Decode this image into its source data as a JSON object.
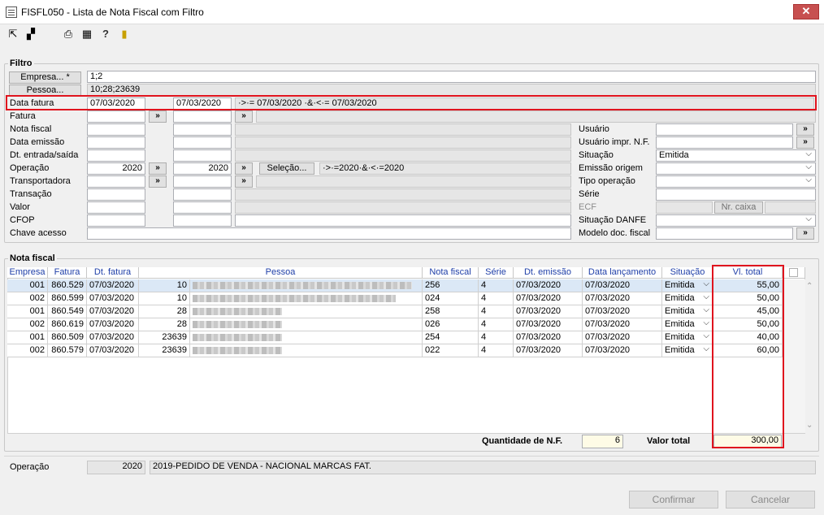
{
  "window": {
    "title": "FISFL050 - Lista de Nota Fiscal com Filtro",
    "close": "✕"
  },
  "filtro": {
    "title": "Filtro",
    "empresa": {
      "label": "Empresa... *",
      "value": "1;2"
    },
    "pessoa": {
      "label": "Pessoa...",
      "value": "10;28;23639"
    },
    "data_fatura": {
      "label": "Data fatura",
      "from": "07/03/2020",
      "to": "07/03/2020",
      "expr": "·>·= 07/03/2020 ·&·<·= 07/03/2020"
    },
    "fatura": {
      "label": "Fatura"
    },
    "nota_fiscal": {
      "label": "Nota fiscal"
    },
    "data_emissao": {
      "label": "Data emissão"
    },
    "dt_entrada_saida": {
      "label": "Dt. entrada/saída"
    },
    "operacao": {
      "label": "Operação",
      "from": "2020",
      "to": "2020",
      "selecao": "Seleção...",
      "expr": "·>·=2020·&·<·=2020"
    },
    "transportadora": {
      "label": "Transportadora"
    },
    "transacao": {
      "label": "Transação"
    },
    "valor": {
      "label": "Valor"
    },
    "cfop": {
      "label": "CFOP"
    },
    "chave_acesso": {
      "label": "Chave acesso"
    },
    "usuario": {
      "label": "Usuário"
    },
    "usuario_impr": {
      "label": "Usuário impr. N.F."
    },
    "situacao": {
      "label": "Situação",
      "value": "Emitida"
    },
    "emissao_origem": {
      "label": "Emissão origem"
    },
    "tipo_operacao": {
      "label": "Tipo operação"
    },
    "serie": {
      "label": "Série"
    },
    "ecf": {
      "label": "ECF",
      "nr_caixa": "Nr. caixa"
    },
    "situacao_danfe": {
      "label": "Situação DANFE"
    },
    "modelo_doc": {
      "label": "Modelo doc. fiscal"
    },
    "arrow": "»"
  },
  "nota_fiscal": {
    "title": "Nota fiscal",
    "columns": [
      "Empresa",
      "Fatura",
      "Dt. fatura",
      "Pessoa",
      "Nota fiscal",
      "Série",
      "Dt. emissão",
      "Data lançamento",
      "Situação",
      "Vl. total"
    ],
    "rows": [
      {
        "empresa": "001",
        "fatura": "860.529",
        "dt_fatura": "07/03/2020",
        "pessoa": "10",
        "nota": "256",
        "serie": "4",
        "dt_emissao": "07/03/2020",
        "data_lanc": "07/03/2020",
        "situacao": "Emitida",
        "vl_total": "55,00"
      },
      {
        "empresa": "002",
        "fatura": "860.599",
        "dt_fatura": "07/03/2020",
        "pessoa": "10",
        "nota": "024",
        "serie": "4",
        "dt_emissao": "07/03/2020",
        "data_lanc": "07/03/2020",
        "situacao": "Emitida",
        "vl_total": "50,00"
      },
      {
        "empresa": "001",
        "fatura": "860.549",
        "dt_fatura": "07/03/2020",
        "pessoa": "28",
        "nota": "258",
        "serie": "4",
        "dt_emissao": "07/03/2020",
        "data_lanc": "07/03/2020",
        "situacao": "Emitida",
        "vl_total": "45,00"
      },
      {
        "empresa": "002",
        "fatura": "860.619",
        "dt_fatura": "07/03/2020",
        "pessoa": "28",
        "nota": "026",
        "serie": "4",
        "dt_emissao": "07/03/2020",
        "data_lanc": "07/03/2020",
        "situacao": "Emitida",
        "vl_total": "50,00"
      },
      {
        "empresa": "001",
        "fatura": "860.509",
        "dt_fatura": "07/03/2020",
        "pessoa": "23639",
        "nota": "254",
        "serie": "4",
        "dt_emissao": "07/03/2020",
        "data_lanc": "07/03/2020",
        "situacao": "Emitida",
        "vl_total": "40,00"
      },
      {
        "empresa": "002",
        "fatura": "860.579",
        "dt_fatura": "07/03/2020",
        "pessoa": "23639",
        "nota": "022",
        "serie": "4",
        "dt_emissao": "07/03/2020",
        "data_lanc": "07/03/2020",
        "situacao": "Emitida",
        "vl_total": "60,00"
      }
    ],
    "quantidade_label": "Quantidade de N.F.",
    "quantidade": "6",
    "valor_total_label": "Valor total",
    "valor_total": "300,00"
  },
  "operacao_info": {
    "label": "Operação",
    "code": "2020",
    "desc": "2019-PEDIDO DE VENDA - NACIONAL MARCAS FAT."
  },
  "buttons": {
    "confirmar": "Confirmar",
    "cancelar": "Cancelar"
  },
  "colors": {
    "highlight": "#e0141e",
    "header_text": "#1f3fa8",
    "selected_row": "#dbe8f6"
  }
}
